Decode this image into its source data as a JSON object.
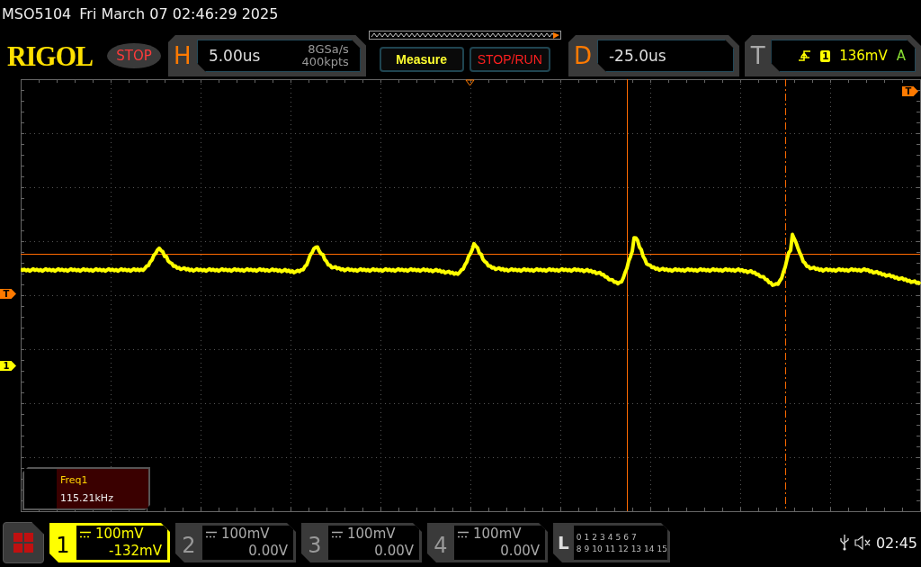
{
  "header": {
    "model": "MSO5104",
    "datetime": "Fri March 07 02:46:29 2025"
  },
  "toolbar": {
    "logo": "RIGOL",
    "run_state": {
      "label": "STOP",
      "kind": "stop"
    },
    "horizontal": {
      "label": "H",
      "timebase": "5.00us",
      "sample_rate": "8GSa/s",
      "memory_depth": "400kpts"
    },
    "measure_button": "Measure",
    "stop_run_button": "STOP/RUN",
    "delay": {
      "label": "D",
      "value": "-25.0us"
    },
    "trigger": {
      "label": "T",
      "source": "1",
      "level": "136mV",
      "mode": "A"
    }
  },
  "display": {
    "markers": [
      {
        "label": "T",
        "kind": "trigger-level"
      },
      {
        "label": "1",
        "kind": "channel-offset"
      },
      {
        "label": "T",
        "kind": "trigger-position"
      }
    ],
    "measurement": {
      "name": "Freq1",
      "value": "115.21kHz"
    }
  },
  "channels": [
    {
      "number": "1",
      "scale": "100mV",
      "offset": "-132mV",
      "selected": true
    },
    {
      "number": "2",
      "scale": "100mV",
      "offset": "0.00V",
      "selected": false
    },
    {
      "number": "3",
      "scale": "100mV",
      "offset": "0.00V",
      "selected": false
    },
    {
      "number": "4",
      "scale": "100mV",
      "offset": "0.00V",
      "selected": false
    }
  ],
  "logic": {
    "label": "L",
    "bits_row_1": [
      "0",
      "1",
      "2",
      "3",
      "4",
      "5",
      "6",
      "7"
    ],
    "bits_row_2": [
      "8",
      "9",
      "10",
      "11",
      "12",
      "13",
      "14",
      "15"
    ]
  },
  "status": {
    "time": "02:45"
  }
}
